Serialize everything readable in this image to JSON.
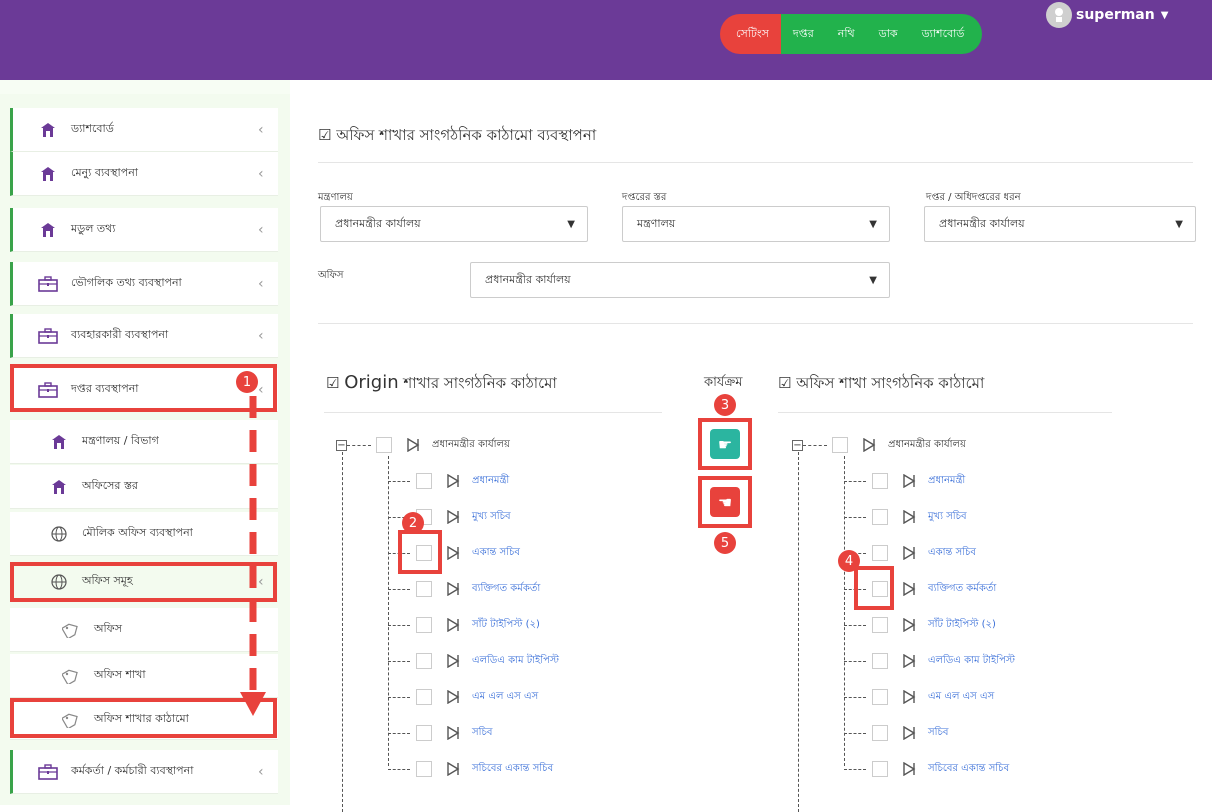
{
  "header": {
    "nav": [
      "সেটিংস",
      "দপ্তর",
      "নথি",
      "ডাক",
      "ড্যাশবোর্ড"
    ],
    "user": "superman",
    "colors": {
      "brand": "#6b3a97",
      "active": "#e8423c",
      "nav": "#22b24c"
    }
  },
  "sidebar": {
    "items": [
      {
        "label": "ড্যাশবোর্ড",
        "icon": "home-icon"
      },
      {
        "label": "মেন্যু ব্যবস্থাপনা",
        "icon": "home-icon"
      },
      {
        "label": "মডুল তথ্য",
        "icon": "home-icon"
      },
      {
        "label": "ভৌগলিক তথ্য ব্যবস্থাপনা",
        "icon": "briefcase-icon"
      },
      {
        "label": "ব্যবহারকারী ব্যবস্থাপনা",
        "icon": "briefcase-icon"
      },
      {
        "label": "দপ্তর ব্যবস্থাপনা",
        "icon": "briefcase-icon"
      },
      {
        "label": "মন্ত্রণালয় / বিভাগ",
        "icon": "home-icon"
      },
      {
        "label": "অফিসের স্তর",
        "icon": "home-icon"
      },
      {
        "label": "মৌলিক অফিস ব্যবস্থাপনা",
        "icon": "globe-icon"
      },
      {
        "label": "অফিস সমূহ",
        "icon": "globe-icon"
      },
      {
        "label": "অফিস",
        "icon": "tag-icon"
      },
      {
        "label": "অফিস শাখা",
        "icon": "tag-icon"
      },
      {
        "label": "অফিস শাখার কাঠামো",
        "icon": "tag-icon"
      },
      {
        "label": "কর্মকর্তা / কর্মচারী ব্যবস্থাপনা",
        "icon": "briefcase-icon"
      }
    ]
  },
  "main": {
    "title": "অফিস শাখার সাংগঠনিক কাঠামো ব্যবস্থাপনা",
    "filters": {
      "ministry_label": "মন্ত্রণালয়",
      "ministry_value": "প্রধানমন্ত্রীর কার্যালয়",
      "layer_label": "দপ্তরের স্তর",
      "layer_value": "মন্ত্রণালয়",
      "type_label": "দপ্তর / অধিদপ্তরের ধরন",
      "type_value": "প্রধানমন্ত্রীর কার্যালয়",
      "office_label": "অফিস",
      "office_value": "প্রধানমন্ত্রীর কার্যালয়"
    },
    "origin_title_en": "Origin",
    "origin_title_bn": "শাখার সাংগঠনিক কাঠামো",
    "action_label": "কার্যক্রম",
    "office_tree_title": "অফিস শাখা সাংগঠনিক কাঠামো",
    "tree_root": "প্রধানমন্ত্রীর কার্যালয়",
    "tree_items": [
      "প্রধানমন্ত্রী",
      "মুখ্য সচিব",
      "একান্ত সচিব",
      "ব্যক্তিগত কর্মকর্তা",
      "সাঁট টাইপিস্ট (২)",
      "এলডিএ কাম টাইপিস্ট",
      "এম এল এস এস",
      "সচিব",
      "সচিবের একান্ত সচিব"
    ],
    "badges": [
      "1",
      "2",
      "3",
      "4",
      "5"
    ]
  }
}
